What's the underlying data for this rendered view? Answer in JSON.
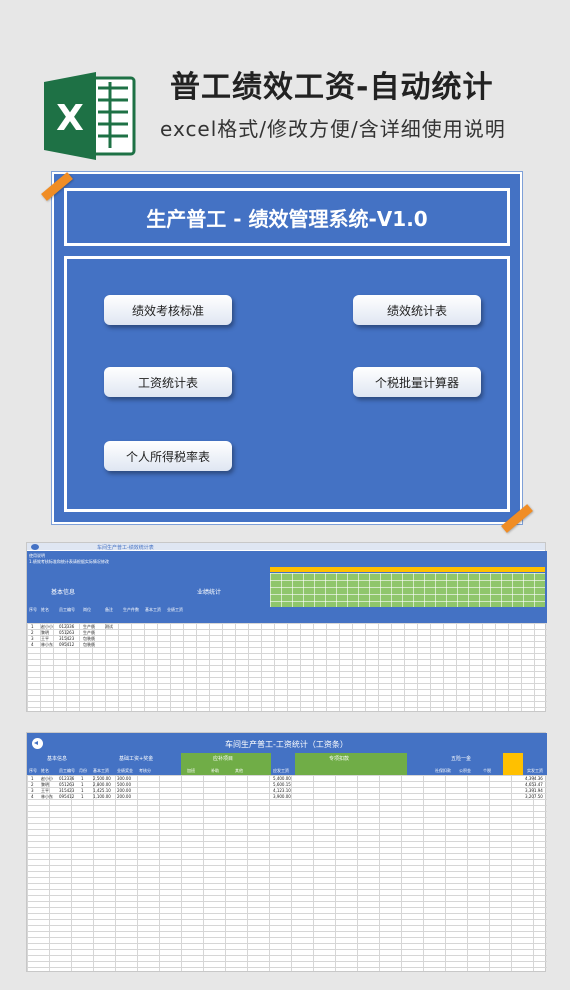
{
  "header": {
    "title": "普工绩效工资-自动统计",
    "subtitle": "excel格式/修改方便/含详细使用说明",
    "logo_letter": "X"
  },
  "menu": {
    "title": "生产普工 - 绩效管理系统-V1.0",
    "buttons": [
      "绩效考核标准",
      "绩效统计表",
      "工资统计表",
      "个税批量计算器",
      "个人所得税率表"
    ]
  },
  "perf_sheet": {
    "title": "车间生产普工-绩效统计表",
    "group_basic": "基本信息",
    "group_perf": "业绩统计",
    "notes": [
      "使用说明",
      "1.绩效考核标准和统计表请根据实际情况修改"
    ],
    "columns": [
      "序号",
      "姓名",
      "员工编号",
      "岗位",
      "备注",
      "生产件数",
      "基本工资",
      "业绩工资"
    ],
    "rows": [
      [
        "1",
        "赵小小",
        "012336",
        "生产线",
        "测试"
      ],
      [
        "2",
        "黎明",
        "051263",
        "生产线",
        ""
      ],
      [
        "3",
        "王平",
        "315423",
        "包装线",
        ""
      ],
      [
        "4",
        "林小东",
        "095412",
        "包装线",
        ""
      ]
    ]
  },
  "salary_sheet": {
    "title": "车间生产普工-工资统计（工资条）",
    "groups": [
      "基本信息",
      "基础工资+奖金",
      "应补项目",
      "专项扣款",
      "五险一金"
    ],
    "columns": [
      "序号",
      "姓名",
      "员工编号",
      "月份",
      "基本工资",
      "业绩奖金",
      "考核分",
      "加班",
      "补助",
      "其他",
      "应发工资",
      "社保扣款",
      "公积金",
      "个税",
      "实发工资"
    ],
    "rows": [
      [
        "1",
        "赵小小",
        "012336",
        "1",
        "2,500.00",
        "300.00",
        "5,400.00",
        "4,394.36"
      ],
      [
        "2",
        "黎明",
        "051263",
        "1",
        "2,800.00",
        "500.00",
        "5,600.15",
        "4,653.47"
      ],
      [
        "3",
        "王平",
        "315423",
        "1",
        "1,425.10",
        "200.00",
        "4,123.10",
        "3,391.94"
      ],
      [
        "4",
        "林小东",
        "095412",
        "1",
        "1,100.00",
        "200.00",
        "3,900.00",
        "3,207.50"
      ]
    ]
  },
  "colors": {
    "brand_blue": "#4472c4",
    "excel_green": "#1e7145",
    "accent_orange": "#f08d25",
    "header_green": "#70ad47",
    "highlight_yellow": "#ffc000"
  }
}
